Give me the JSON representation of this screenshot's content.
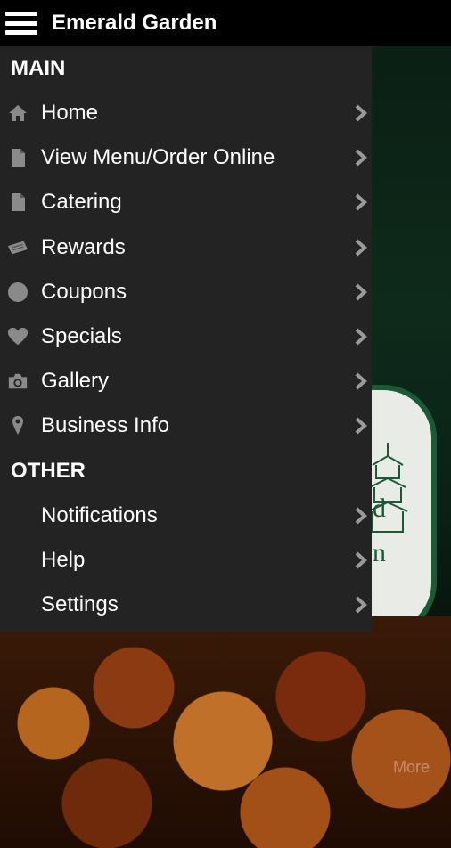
{
  "appbar": {
    "title": "Emerald Garden"
  },
  "drawer": {
    "main_header": "MAIN",
    "main_items": [
      {
        "label": "Home",
        "icon": "home-icon"
      },
      {
        "label": "View Menu/Order Online",
        "icon": "document-icon"
      },
      {
        "label": "Catering",
        "icon": "document-icon"
      },
      {
        "label": "Rewards",
        "icon": "ticket-icon"
      },
      {
        "label": "Coupons",
        "icon": "circle-icon"
      },
      {
        "label": "Specials",
        "icon": "heart-icon"
      },
      {
        "label": "Gallery",
        "icon": "camera-icon"
      },
      {
        "label": "Business Info",
        "icon": "map-pin-icon"
      }
    ],
    "other_header": "OTHER",
    "other_items": [
      {
        "label": "Notifications"
      },
      {
        "label": "Help"
      },
      {
        "label": "Settings"
      }
    ]
  },
  "background": {
    "emblem_letters_1": "d",
    "emblem_letters_2": "n",
    "more_label": "More"
  },
  "colors": {
    "drawer_bg": "#232323",
    "appbar_bg": "#000000",
    "icon_gray": "#8a8a8a",
    "chevron_gray": "#9a9a9a",
    "emblem_green": "#1c5a36"
  }
}
